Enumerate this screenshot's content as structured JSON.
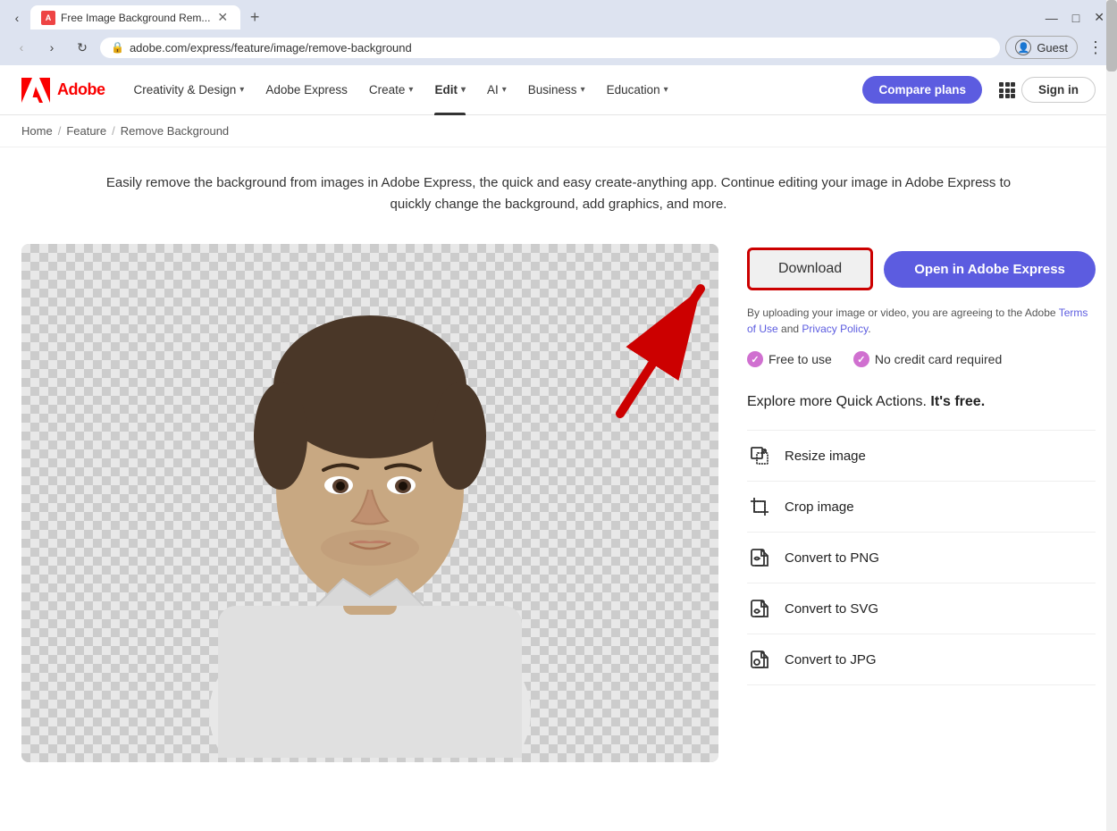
{
  "browser": {
    "tab_title": "Free Image Background Rem...",
    "tab_icon_label": "A",
    "url": "adobe.com/express/feature/image/remove-background",
    "profile_label": "Guest",
    "window_minimize": "—",
    "window_maximize": "□",
    "window_close": "✕"
  },
  "page_title": "Image Background",
  "nav": {
    "logo_text": "Adobe",
    "items": [
      {
        "label": "Creativity & Design",
        "has_chevron": true,
        "active": false
      },
      {
        "label": "Adobe Express",
        "has_chevron": false,
        "active": false
      },
      {
        "label": "Create",
        "has_chevron": true,
        "active": false
      },
      {
        "label": "Edit",
        "has_chevron": true,
        "active": true
      },
      {
        "label": "AI",
        "has_chevron": true,
        "active": false
      },
      {
        "label": "Business",
        "has_chevron": true,
        "active": false
      },
      {
        "label": "Education",
        "has_chevron": true,
        "active": false
      }
    ],
    "compare_plans": "Compare plans",
    "sign_in": "Sign in"
  },
  "breadcrumb": {
    "items": [
      "Home",
      "Feature",
      "Remove Background"
    ],
    "separators": [
      "/",
      "/"
    ]
  },
  "hero": {
    "description": "Easily remove the background from images in Adobe Express, the quick and easy create-anything app. Continue editing your image in Adobe Express to quickly change the background, add graphics, and more."
  },
  "actions": {
    "download_label": "Download",
    "open_express_label": "Open in Adobe Express",
    "terms_part1": "By uploading your image or video, you are agreeing to the Adobe",
    "terms_link1": "Terms of Use",
    "terms_and": "and",
    "terms_link2": "Privacy Policy",
    "terms_period": ".",
    "features": [
      {
        "label": "Free to use"
      },
      {
        "label": "No credit card required"
      }
    ]
  },
  "explore": {
    "title_part1": "Explore more Quick Actions.",
    "title_bold": "It's free.",
    "items": [
      {
        "label": "Resize image",
        "icon": "resize"
      },
      {
        "label": "Crop image",
        "icon": "crop"
      },
      {
        "label": "Convert to PNG",
        "icon": "png"
      },
      {
        "label": "Convert to SVG",
        "icon": "svg"
      },
      {
        "label": "Convert to JPG",
        "icon": "jpg"
      }
    ]
  }
}
